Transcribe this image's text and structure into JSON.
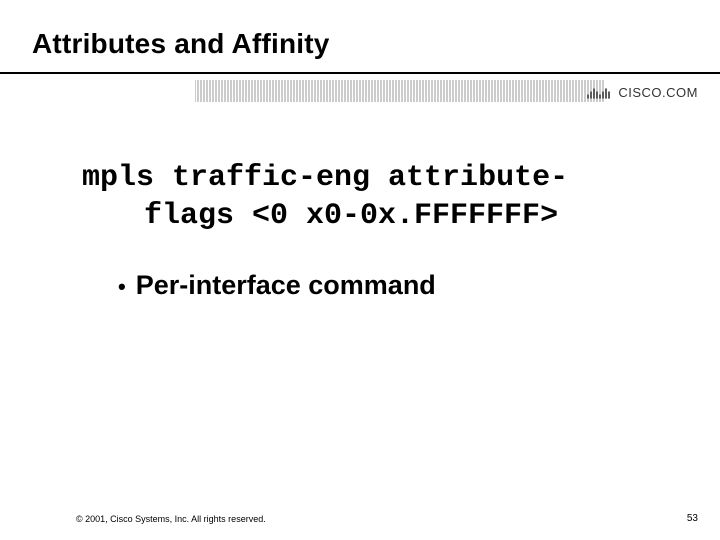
{
  "slide": {
    "title": "Attributes and Affinity",
    "command_line1": "mpls traffic-eng attribute-",
    "command_line2": "flags <0 x0-0x.FFFFFFF>",
    "bullets": [
      "Per-interface command"
    ],
    "footer_copyright": "© 2001, Cisco Systems, Inc. All rights reserved.",
    "page_number": "53",
    "logo_text": "CISCO.COM"
  },
  "colors": {
    "text": "#000000",
    "logo": "#333333"
  }
}
